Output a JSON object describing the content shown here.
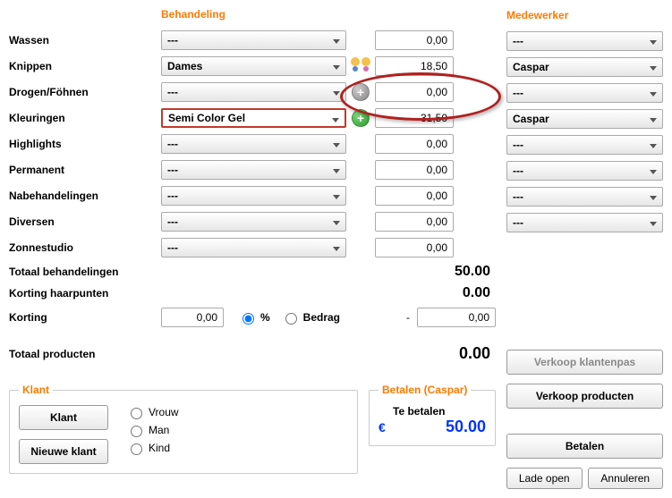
{
  "headers": {
    "behandeling": "Behandeling",
    "medewerker": "Medewerker"
  },
  "placeholder_sel": "---",
  "rows": [
    {
      "label": "Wassen",
      "sel": "---",
      "price": "0,00",
      "med": "---",
      "highlighted": false,
      "icon": null
    },
    {
      "label": "Knippen",
      "sel": "Dames",
      "price": "18,50",
      "med": "Caspar",
      "highlighted": false,
      "icon": "people"
    },
    {
      "label": "Drogen/Föhnen",
      "sel": "---",
      "price": "0,00",
      "med": "---",
      "highlighted": false,
      "icon": "plus-grey"
    },
    {
      "label": "Kleuringen",
      "sel": "Semi Color Gel",
      "price": "31,50",
      "med": "Caspar",
      "highlighted": true,
      "icon": "plus-green"
    },
    {
      "label": "Highlights",
      "sel": "---",
      "price": "0,00",
      "med": "---",
      "highlighted": false,
      "icon": null
    },
    {
      "label": "Permanent",
      "sel": "---",
      "price": "0,00",
      "med": "---",
      "highlighted": false,
      "icon": null
    },
    {
      "label": "Nabehandelingen",
      "sel": "---",
      "price": "0,00",
      "med": "---",
      "highlighted": false,
      "icon": null
    },
    {
      "label": "Diversen",
      "sel": "---",
      "price": "0,00",
      "med": "---",
      "highlighted": false,
      "icon": null
    },
    {
      "label": "Zonnestudio",
      "sel": "---",
      "price": "0,00",
      "med": null,
      "highlighted": false,
      "icon": null
    }
  ],
  "totals": {
    "behandelingen_label": "Totaal behandelingen",
    "behandelingen_val": "50.00",
    "korting_haarpunten_label": "Korting haarpunten",
    "korting_haarpunten_val": "0.00",
    "korting_label": "Korting",
    "korting_input": "0,00",
    "korting_pct_label": "%",
    "korting_bedrag_label": "Bedrag",
    "korting_sep": "-",
    "korting_result": "0,00",
    "producten_label": "Totaal producten",
    "producten_val": "0.00"
  },
  "buttons": {
    "verkoop_klantenpas": "Verkoop klantenpas",
    "verkoop_producten": "Verkoop producten",
    "klant": "Klant",
    "nieuwe_klant": "Nieuwe klant",
    "betalen": "Betalen",
    "lade_open": "Lade open",
    "annuleren": "Annuleren"
  },
  "klant": {
    "legend": "Klant",
    "gender": {
      "vrouw": "Vrouw",
      "man": "Man",
      "kind": "Kind"
    }
  },
  "betalen": {
    "legend": "Betalen (Caspar)",
    "te_betalen_label": "Te betalen",
    "euro": "€",
    "amount": "50.00"
  }
}
